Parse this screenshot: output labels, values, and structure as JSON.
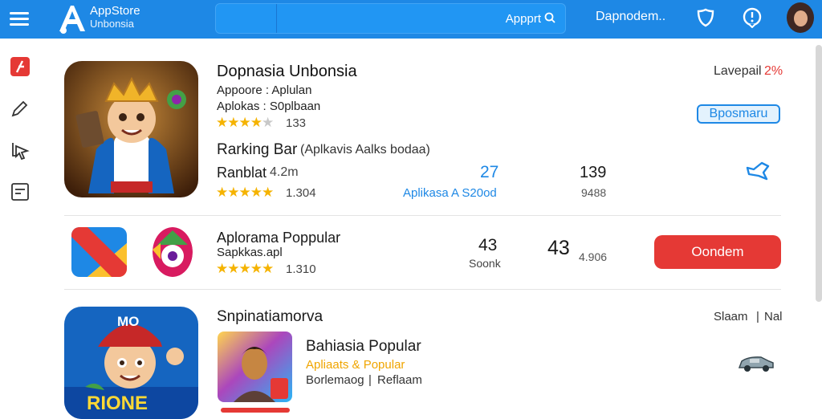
{
  "topbar": {
    "logo_title": "AppStore",
    "logo_sub": "Unbonsia",
    "search_placeholder": "Appprt",
    "nav_link": "Dapnodem..",
    "colors": {
      "bar": "#1e88e5",
      "accent_red": "#e53935",
      "star": "#f5b301"
    }
  },
  "sidebar": {
    "items": [
      {
        "icon": "flag-icon"
      },
      {
        "icon": "edit-icon"
      },
      {
        "icon": "cursor-icon"
      },
      {
        "icon": "document-icon"
      }
    ]
  },
  "featured": {
    "title": "Dopnasia Unbonsia",
    "line1": "Appoore : Aplulan",
    "line2": "Aplokas : S0plbaan",
    "rating_count": "133",
    "label_top": "Lavepail",
    "label_pct": "2%",
    "badge": "Bposmaru",
    "ranking_title": "Rarking Bar",
    "ranking_sub": "(Aplkavis Aalks bodaa)",
    "stat_label": "Ranblat",
    "stat_value": "4.2m",
    "rating2_count": "1.304",
    "mid_number": "27",
    "mid_caption": "Aplikasa A S20od",
    "right_number": "139",
    "right_caption": "9488"
  },
  "popular_row": {
    "title": "Aplorama Poppular",
    "sub": "Sapkkas.apl",
    "rating_count": "1.310",
    "n1": "43",
    "n1_caption": "Soonk",
    "n2": "43",
    "n2_caption": "4.906",
    "install_label": "Oondem"
  },
  "section": {
    "title": "Snpinatiamorva",
    "right_a": "Slaam",
    "right_sep": "|",
    "right_b": "Nal",
    "logo_text": "RIONE",
    "logo_hat": "MO",
    "item_title": "Bahiasia Popular",
    "item_sub": "Apliaats & Popular",
    "item_meta_a": "Borlemaog",
    "item_meta_sep": "|",
    "item_meta_b": "Reflaam"
  }
}
